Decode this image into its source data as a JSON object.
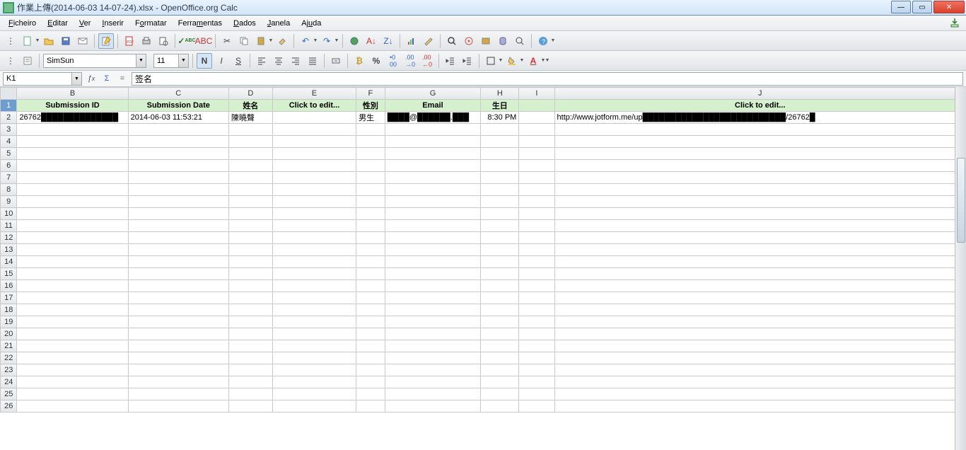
{
  "window": {
    "title": "作業上傳(2014-06-03 14-07-24).xlsx - OpenOffice.org Calc"
  },
  "menu": {
    "ficheiro": "Ficheiro",
    "editar": "Editar",
    "ver": "Ver",
    "inserir": "Inserir",
    "formatar": "Formatar",
    "ferramentas": "Ferramentas",
    "dados": "Dados",
    "janela": "Janela",
    "ajuda": "Ajuda"
  },
  "format": {
    "font_name": "SimSun",
    "font_size": "11"
  },
  "formula_bar": {
    "cell_ref": "K1",
    "value": "签名"
  },
  "columns": [
    "B",
    "C",
    "D",
    "E",
    "F",
    "G",
    "H",
    "I",
    "J"
  ],
  "header_row": {
    "B": "Submission ID",
    "C": "Submission Date",
    "D": "姓名",
    "E": "Click to edit...",
    "F": "性別",
    "G": "Email",
    "H": "生日",
    "I": "",
    "J": "Click to edit..."
  },
  "data_row": {
    "B": "26762██████████████",
    "C": "2014-06-03 11:53:21",
    "D": "陳曉聲",
    "E": "",
    "F": "男生",
    "G": "████@██████.███",
    "H": "8:30 PM",
    "I": "",
    "J": "http://www.jotform.me/up██████████████████████████/26762█"
  },
  "row_count": 26
}
